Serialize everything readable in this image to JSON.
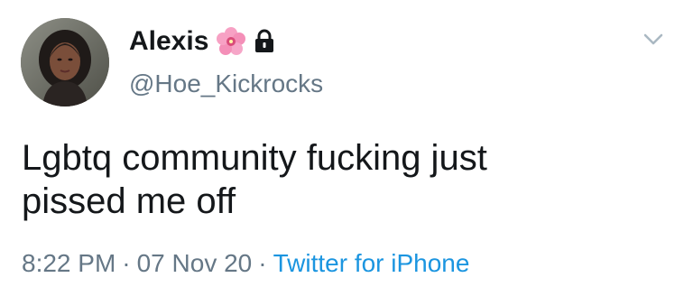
{
  "tweet": {
    "author": {
      "display_name": "Alexis",
      "handle": "@Hoe_Kickrocks",
      "name_badges": [
        "flower-icon",
        "lock-icon"
      ]
    },
    "text": "Lgbtq community fucking just\npissed me off",
    "time": "8:22 PM",
    "separator_1": "·",
    "date": "07 Nov 20",
    "separator_2": "·",
    "source": "Twitter for iPhone"
  },
  "colors": {
    "text_primary": "#14171a",
    "text_secondary": "#657786",
    "link": "#1b95e0",
    "chevron": "#aab8c2",
    "flower": "#f7a1c4"
  },
  "icons": {
    "more_menu": "chevron-down-icon",
    "avatar": "avatar"
  }
}
